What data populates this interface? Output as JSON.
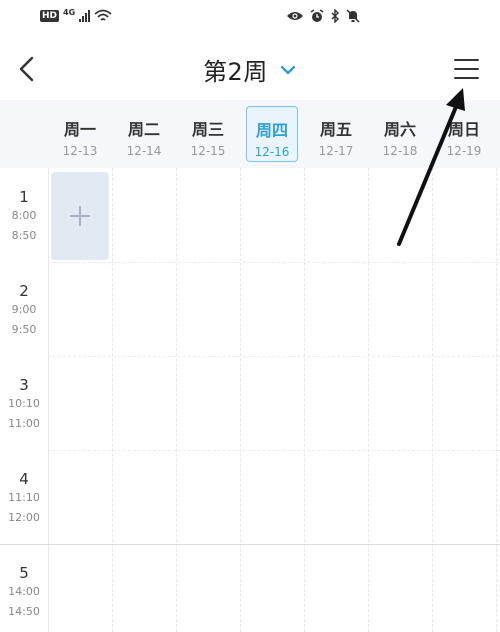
{
  "status_bar": {
    "hd_label": "HD",
    "network_label": "4G"
  },
  "header": {
    "week_title": "第2周"
  },
  "days": [
    {
      "name": "周一",
      "date": "12-13",
      "selected": false
    },
    {
      "name": "周二",
      "date": "12-14",
      "selected": false
    },
    {
      "name": "周三",
      "date": "12-15",
      "selected": false
    },
    {
      "name": "周四",
      "date": "12-16",
      "selected": true
    },
    {
      "name": "周五",
      "date": "12-17",
      "selected": false
    },
    {
      "name": "周六",
      "date": "12-18",
      "selected": false
    },
    {
      "name": "周日",
      "date": "12-19",
      "selected": false
    }
  ],
  "periods": [
    {
      "num": "1",
      "start": "8:00",
      "end": "8:50"
    },
    {
      "num": "2",
      "start": "9:00",
      "end": "9:50"
    },
    {
      "num": "3",
      "start": "10:10",
      "end": "11:00"
    },
    {
      "num": "4",
      "start": "11:10",
      "end": "12:00"
    },
    {
      "num": "5",
      "start": "14:00",
      "end": "14:50"
    }
  ],
  "colors": {
    "accent": "#2e9fd8",
    "selected_bg": "#e9f4fb",
    "add_cell_bg": "#e3e9f3",
    "annotation_arrow": "#111111"
  },
  "icons": {
    "back": "back-arrow-icon",
    "dropdown": "chevron-down-icon",
    "menu": "menu-icon",
    "add": "plus-icon"
  }
}
